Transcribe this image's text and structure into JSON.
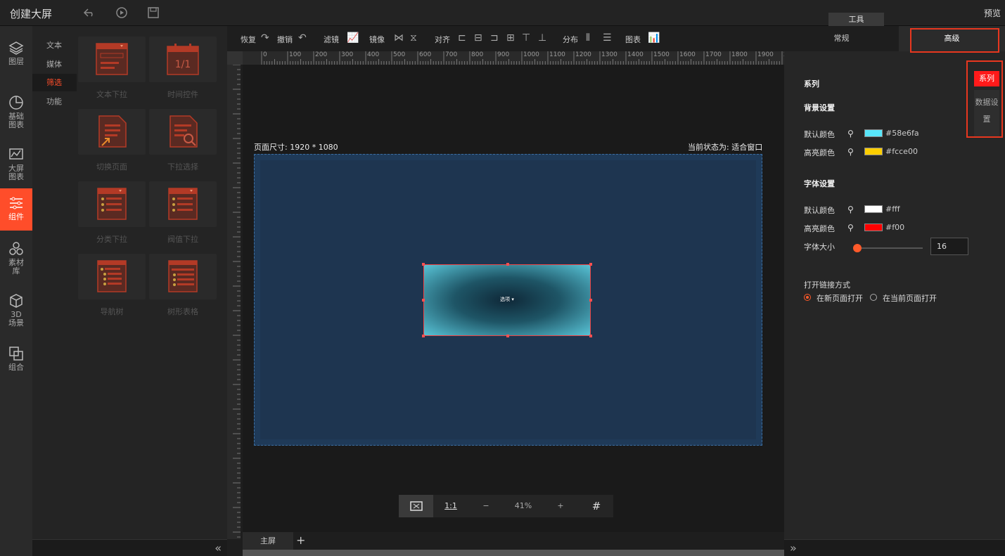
{
  "app": {
    "title": "创建大屏",
    "preview": "预览",
    "tool_tab": "工具"
  },
  "leftnav": [
    {
      "id": "layers",
      "label": "图层",
      "icon": "layers-icon"
    },
    {
      "id": "basic-chart",
      "label": "基础\n图表",
      "icon": "pie-chart-icon"
    },
    {
      "id": "big-chart",
      "label": "大屏\n图表",
      "icon": "area-chart-icon"
    },
    {
      "id": "components",
      "label": "组件",
      "icon": "sliders-icon"
    },
    {
      "id": "assets",
      "label": "素材\n库",
      "icon": "shapes-icon"
    },
    {
      "id": "scene3d",
      "label": "3D\n场景",
      "icon": "cube-icon"
    },
    {
      "id": "group",
      "label": "组合",
      "icon": "group-icon"
    }
  ],
  "subnav": [
    "文本",
    "媒体",
    "筛选",
    "功能"
  ],
  "components": [
    {
      "label": "文本下拉",
      "icon": "dropdown-text-icon"
    },
    {
      "label": "时间控件",
      "icon": "calendar-icon"
    },
    {
      "label": "切换页面",
      "icon": "switch-page-icon"
    },
    {
      "label": "下拉选择",
      "icon": "dropdown-search-icon"
    },
    {
      "label": "分类下拉",
      "icon": "category-dropdown-icon"
    },
    {
      "label": "阀值下拉",
      "icon": "threshold-dropdown-icon"
    },
    {
      "label": "导航树",
      "icon": "nav-tree-icon"
    },
    {
      "label": "树形表格",
      "icon": "tree-table-icon"
    }
  ],
  "toolbar": {
    "restore": "恢复",
    "undo": "撤销",
    "filter": "滤镜",
    "mirror": "镜像",
    "align": "对齐",
    "distribute": "分布",
    "chart": "图表"
  },
  "ruler": {
    "h_ticks": [
      "0",
      "100",
      "200",
      "300",
      "400",
      "500",
      "600",
      "700",
      "800",
      "900",
      "1000",
      "1100",
      "1200",
      "1300",
      "1400",
      "1500",
      "1600",
      "1700",
      "1800",
      "1900",
      "20"
    ]
  },
  "canvas": {
    "page_size": "页面尺寸: 1920 * 1080",
    "current_state": "当前状态为: 适合窗口",
    "widget_text": "选项"
  },
  "zoom": {
    "one_to_one": "1:1",
    "minus": "−",
    "value": "41%",
    "plus": "+"
  },
  "screens": {
    "main": "主屏",
    "add": "+"
  },
  "right": {
    "tabs": [
      "常规",
      "高级"
    ],
    "side_tabs": [
      "系列",
      "数据设",
      "置"
    ],
    "series_title": "系列",
    "bg_title": "背景设置",
    "bg_default_label": "默认颜色",
    "bg_default_color": "#58e6fa",
    "bg_highlight_label": "高亮颜色",
    "bg_highlight_color": "#fcce00",
    "font_title": "字体设置",
    "font_default_label": "默认颜色",
    "font_default_color": "#fff",
    "font_highlight_label": "高亮颜色",
    "font_highlight_color": "#f00",
    "font_size_label": "字体大小",
    "font_size": "16",
    "link_title": "打开链接方式",
    "link_new": "在新页面打开",
    "link_current": "在当前页面打开"
  }
}
